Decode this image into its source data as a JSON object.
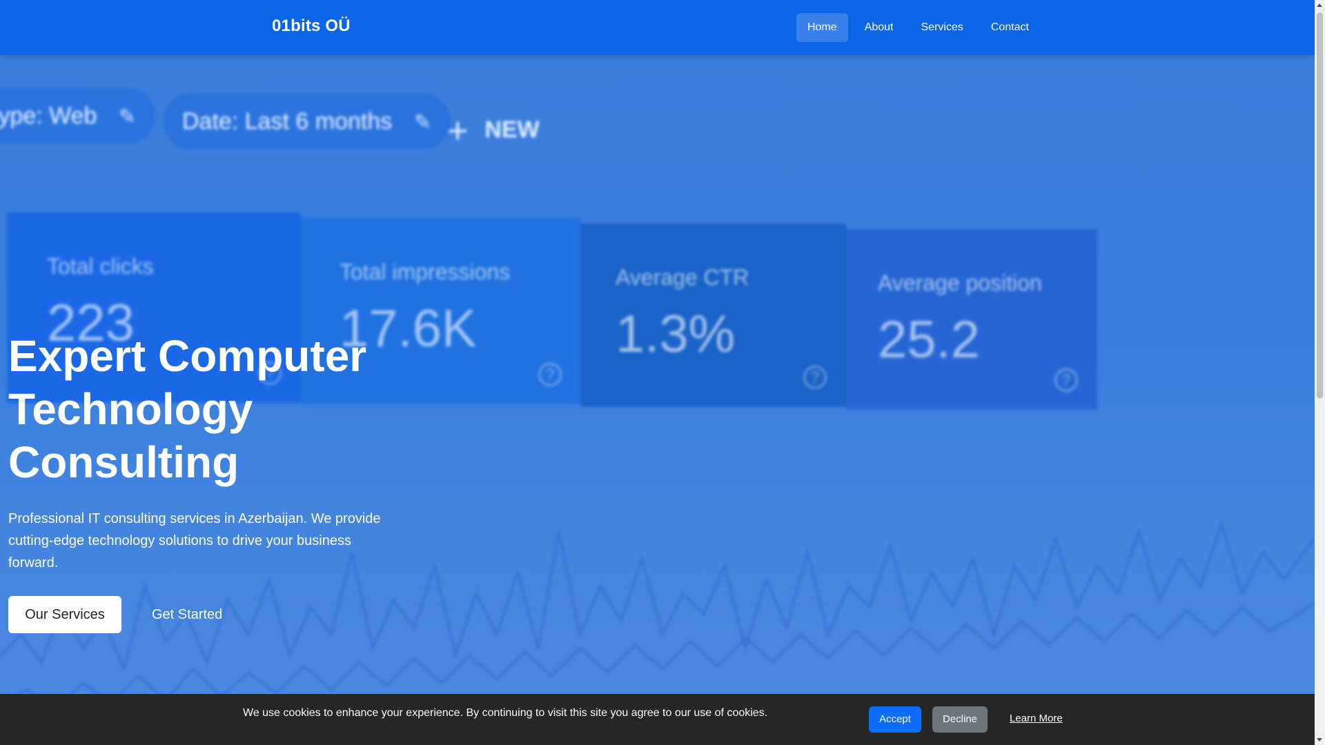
{
  "header": {
    "brand": "01bits OÜ",
    "nav": [
      {
        "label": "Home",
        "active": true
      },
      {
        "label": "About",
        "active": false
      },
      {
        "label": "Services",
        "active": false
      },
      {
        "label": "Contact",
        "active": false
      }
    ]
  },
  "hero_background": {
    "filter_pills": [
      {
        "label": "type: Web"
      },
      {
        "label": "Date: Last 6 months"
      }
    ],
    "new_button": "NEW",
    "metrics": [
      {
        "label": "Total clicks",
        "value": "223"
      },
      {
        "label": "Total impressions",
        "value": "17.6K"
      },
      {
        "label": "Average CTR",
        "value": "1.3%"
      },
      {
        "label": "Average position",
        "value": "25.2"
      }
    ],
    "icons": {
      "pencil": "pencil-icon",
      "plus": "plus-icon",
      "help": "help-circle-icon"
    }
  },
  "hero": {
    "title": "Expert Computer Technology Consulting",
    "description": "Professional IT consulting services in Azerbaijan. We provide cutting-edge technology solutions to drive your business forward.",
    "primary_button": "Our Services",
    "secondary_button": "Get Started"
  },
  "cookie_banner": {
    "text": "We use cookies to enhance your experience. By continuing to visit this site you agree to our use of cookies.",
    "accept": "Accept",
    "decline": "Decline",
    "learn_more": "Learn More"
  },
  "colors": {
    "header": "#0a66e6",
    "hero": "#3b7ddb",
    "cookie_bg": "#262626",
    "accept": "#0d6efd",
    "decline": "#6c757d"
  }
}
